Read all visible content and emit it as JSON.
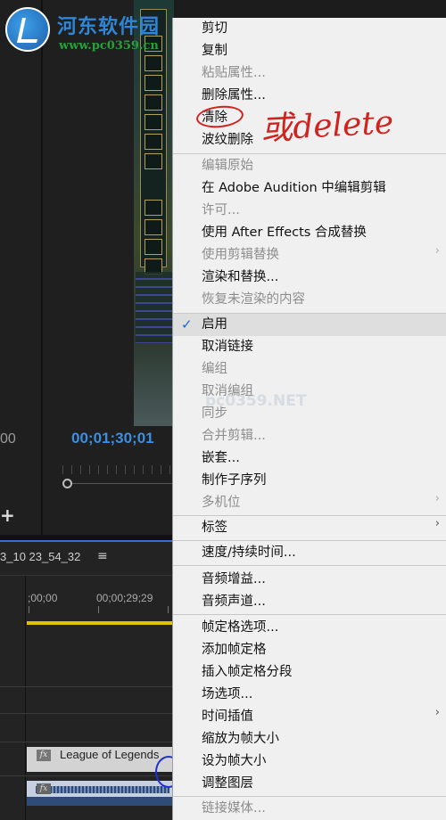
{
  "watermark": {
    "title": "河东软件园",
    "url": "www.pc0359.cn",
    "overlay": "pc0359.NET"
  },
  "monitor": {
    "timecode_left": "00",
    "timecode_current": "00;01;30;01",
    "add_button": "+"
  },
  "timeline": {
    "sequence_name": "3_10 23_54_32",
    "menu_glyph": "≡",
    "ruler_times": [
      ";00;00",
      "00;00;29;29"
    ],
    "clip_name": "League of Legends",
    "fx_badge": "fx",
    "work_area_color": "#e0c200",
    "playhead_color": "#3b6bd6"
  },
  "annotation": {
    "text": "或delete",
    "color": "#d0221e"
  },
  "context_menu": {
    "items": [
      {
        "label": "剪切",
        "enabled": true
      },
      {
        "label": "复制",
        "enabled": true
      },
      {
        "label": "粘贴属性...",
        "enabled": false
      },
      {
        "label": "删除属性...",
        "enabled": true
      },
      {
        "label": "清除",
        "enabled": true,
        "highlighted_by_annotation": true
      },
      {
        "label": "波纹删除",
        "enabled": true
      },
      {
        "label": "编辑原始",
        "enabled": false
      },
      {
        "label": "在 Adobe Audition 中编辑剪辑",
        "enabled": true
      },
      {
        "label": "许可...",
        "enabled": false
      },
      {
        "label": "使用 After Effects 合成替换",
        "enabled": true
      },
      {
        "label": "使用剪辑替换",
        "enabled": false,
        "submenu": true
      },
      {
        "label": "渲染和替换...",
        "enabled": true
      },
      {
        "label": "恢复未渲染的内容",
        "enabled": false
      },
      {
        "label": "启用",
        "enabled": true,
        "checked": true
      },
      {
        "label": "取消链接",
        "enabled": true
      },
      {
        "label": "编组",
        "enabled": false
      },
      {
        "label": "取消编组",
        "enabled": false
      },
      {
        "label": "同步",
        "enabled": false
      },
      {
        "label": "合并剪辑...",
        "enabled": false
      },
      {
        "label": "嵌套...",
        "enabled": true
      },
      {
        "label": "制作子序列",
        "enabled": true
      },
      {
        "label": "多机位",
        "enabled": false,
        "submenu": true
      },
      {
        "label": "标签",
        "enabled": true,
        "submenu": true
      },
      {
        "label": "速度/持续时间...",
        "enabled": true
      },
      {
        "label": "音频增益...",
        "enabled": true
      },
      {
        "label": "音频声道...",
        "enabled": true
      },
      {
        "label": "帧定格选项...",
        "enabled": true
      },
      {
        "label": "添加帧定格",
        "enabled": true
      },
      {
        "label": "插入帧定格分段",
        "enabled": true
      },
      {
        "label": "场选项...",
        "enabled": true
      },
      {
        "label": "时间插值",
        "enabled": true,
        "submenu": true
      },
      {
        "label": "缩放为帧大小",
        "enabled": true
      },
      {
        "label": "设为帧大小",
        "enabled": true
      },
      {
        "label": "调整图层",
        "enabled": true
      },
      {
        "label": "链接媒体...",
        "enabled": false
      }
    ],
    "check_glyph": "✓",
    "submenu_glyph": "›"
  }
}
